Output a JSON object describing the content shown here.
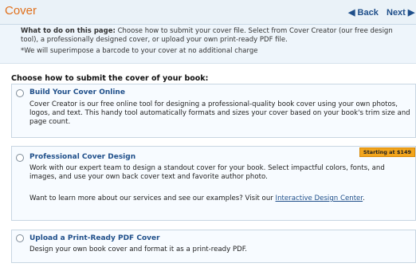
{
  "header": {
    "title": "Cover",
    "back_label": "◀ Back",
    "next_label": "Next ▶"
  },
  "intro": {
    "label": "What to do on this page:",
    "text": " Choose how to submit your cover file. Select from Cover Creator (our free design tool), a professionally designed cover, or upload your own print-ready PDF file.",
    "note": "*We will superimpose a barcode to your cover at no additional charge"
  },
  "section": {
    "heading": "Choose how to submit the cover of your book:"
  },
  "options": [
    {
      "title": "Build Your Cover Online",
      "description": "Cover Creator is our free online tool for designing a professional-quality book cover using your own photos, logos, and text. This handy tool automatically formats and sizes your cover based on your book's trim size and page count."
    },
    {
      "title": "Professional Cover Design",
      "badge": "Starting at $149",
      "description": "Work with our expert team to design a standout cover for your book. Select impactful colors, fonts, and images, and use your own back cover text and favorite author photo.",
      "more_prefix": "Want to learn more about our services and see our examples? Visit our ",
      "link_text": "Interactive Design Center",
      "more_suffix": "."
    },
    {
      "title": "Upload a Print-Ready PDF Cover",
      "description": "Design your own book cover and format it as a print-ready PDF."
    }
  ]
}
